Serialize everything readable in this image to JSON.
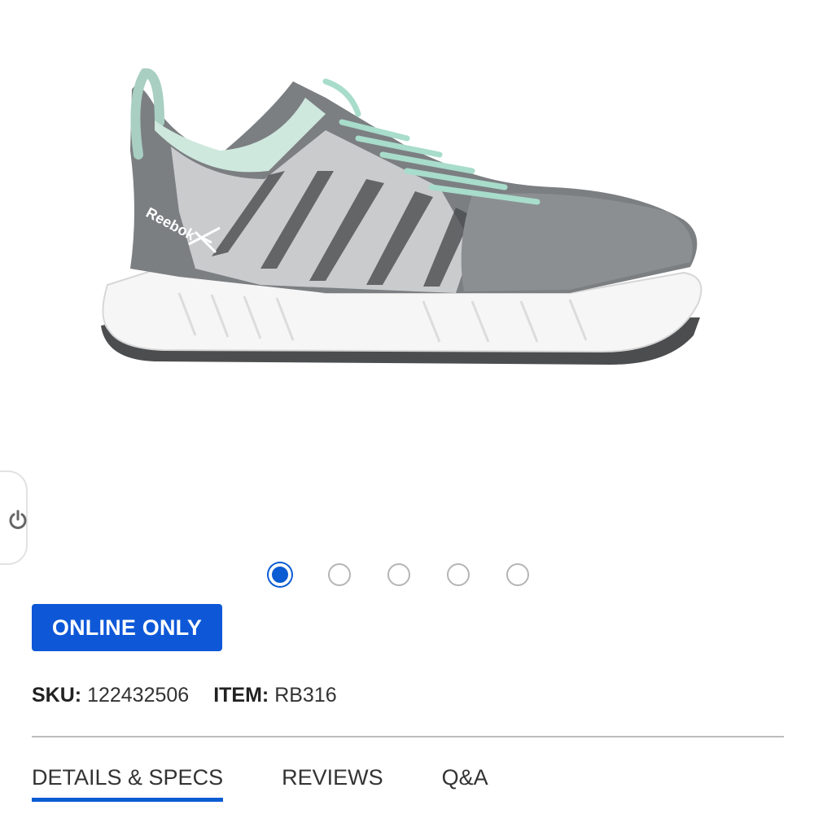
{
  "product": {
    "image_alt": "Reebok work shoe, side view",
    "brand_mark": "Reebok",
    "badge": "ONLINE ONLY",
    "sku_label": "SKU:",
    "sku": "122432506",
    "item_label": "ITEM:",
    "item": "RB316"
  },
  "carousel": {
    "count": 5,
    "active_index": 0
  },
  "tabs": [
    {
      "label": "DETAILS & SPECS",
      "active": true
    },
    {
      "label": "REVIEWS",
      "active": false
    },
    {
      "label": "Q&A",
      "active": false
    }
  ],
  "icons": {
    "side_tab": "power-icon"
  },
  "colors": {
    "accent": "#0b5bd3",
    "badge": "#0e58d8",
    "shoe_gray": "#7c7f82",
    "lace_mint": "#a8dccb"
  }
}
